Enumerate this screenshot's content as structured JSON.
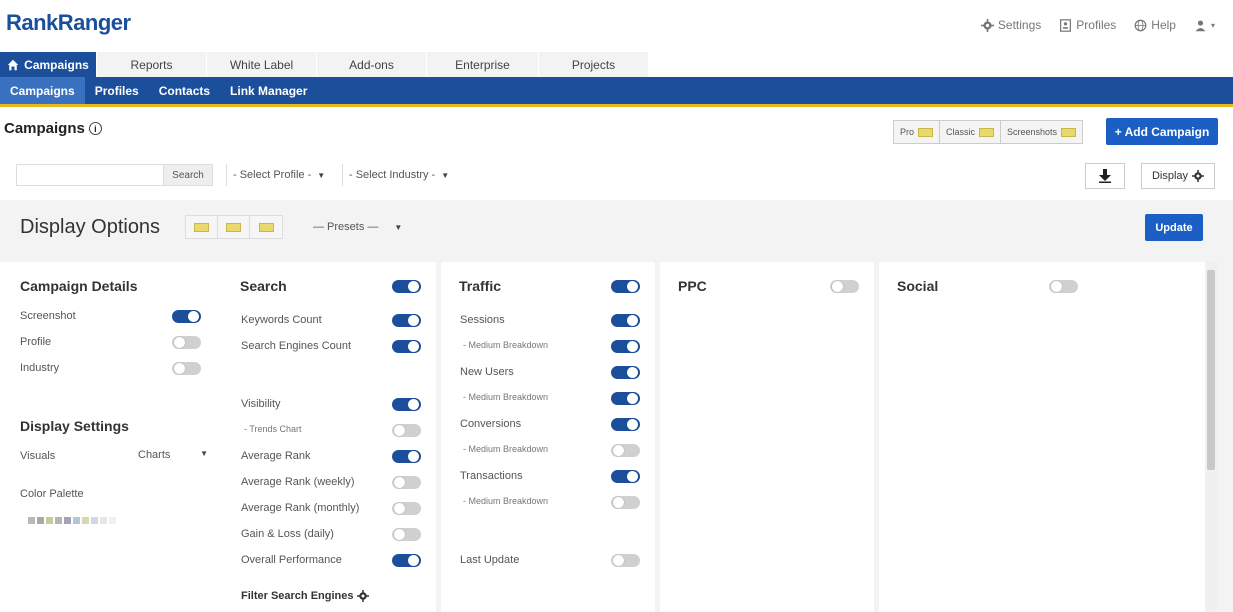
{
  "logo": {
    "rank": "Rank",
    "ranger": "Ranger"
  },
  "top_links": [
    {
      "label": "Settings",
      "icon": "gear-icon"
    },
    {
      "label": "Profiles",
      "icon": "profile-icon"
    },
    {
      "label": "Help",
      "icon": "globe-icon"
    },
    {
      "label": "",
      "icon": "user-icon"
    }
  ],
  "main_tabs": [
    "Campaigns",
    "Reports",
    "White Label",
    "Add-ons",
    "Enterprise",
    "Projects"
  ],
  "sub_nav": [
    "Campaigns",
    "Profiles",
    "Contacts",
    "Link Manager"
  ],
  "page": {
    "title": "Campaigns",
    "info": "i",
    "views": [
      "Pro",
      "Classic",
      "Screenshots"
    ],
    "add_campaign": "+ Add Campaign"
  },
  "filters": {
    "search_placeholder": "",
    "search_button": "Search",
    "select_profile": "- Select Profile -",
    "select_industry": "- Select Industry -",
    "display": "Display"
  },
  "display_options": {
    "title": "Display Options",
    "presets": "— Presets —",
    "update": "Update"
  },
  "campaign_details": {
    "title": "Campaign Details",
    "items": [
      {
        "label": "Screenshot",
        "on": true
      },
      {
        "label": "Profile",
        "on": false
      },
      {
        "label": "Industry",
        "on": false
      }
    ]
  },
  "display_settings": {
    "title": "Display Settings",
    "visuals_label": "Visuals",
    "visuals_value": "Charts",
    "palette_label": "Color Palette",
    "palette_colors": [
      "#b9b9b9",
      "#a9a9a9",
      "#c9c99a",
      "#b6b6b6",
      "#a3a3b3",
      "#b8c4d8",
      "#d8d8b0",
      "#cfd8e6",
      "#e6e6e6",
      "#f0f0f0"
    ]
  },
  "search": {
    "title": "Search",
    "on": true,
    "items": [
      {
        "label": "Keywords Count",
        "on": true,
        "small": false
      },
      {
        "label": "Search Engines Count",
        "on": true,
        "small": false
      },
      {
        "label": "Visibility",
        "on": true,
        "small": false
      },
      {
        "label": "- Trends Chart",
        "on": false,
        "small": true
      },
      {
        "label": "Average Rank",
        "on": true,
        "small": false
      },
      {
        "label": "Average Rank (weekly)",
        "on": false,
        "small": false
      },
      {
        "label": "Average Rank (monthly)",
        "on": false,
        "small": false
      },
      {
        "label": "Gain & Loss (daily)",
        "on": false,
        "small": false
      },
      {
        "label": "Overall Performance",
        "on": true,
        "small": false
      }
    ],
    "filter_label": "Filter Search Engines"
  },
  "traffic": {
    "title": "Traffic",
    "on": true,
    "items": [
      {
        "label": "Sessions",
        "on": true,
        "small": false
      },
      {
        "label": "- Medium Breakdown",
        "on": true,
        "small": true
      },
      {
        "label": "New Users",
        "on": true,
        "small": false
      },
      {
        "label": "- Medium Breakdown",
        "on": true,
        "small": true
      },
      {
        "label": "Conversions",
        "on": true,
        "small": false
      },
      {
        "label": "- Medium Breakdown",
        "on": false,
        "small": true
      },
      {
        "label": "Transactions",
        "on": true,
        "small": false
      },
      {
        "label": "- Medium Breakdown",
        "on": false,
        "small": true
      },
      {
        "label": "Last Update",
        "on": false,
        "small": false
      }
    ]
  },
  "ppc": {
    "title": "PPC",
    "on": false
  },
  "social": {
    "title": "Social",
    "on": false
  },
  "colors": {
    "brand": "#1b4f9c",
    "accent": "#e8b71a",
    "button": "#1b5fc4"
  }
}
